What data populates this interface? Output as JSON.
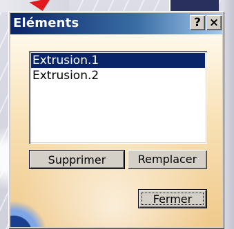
{
  "dialog": {
    "title": "Eléments",
    "help_glyph": "?",
    "close_glyph": "×"
  },
  "list": {
    "items": [
      {
        "label": "Extrusion.1",
        "selected": true
      },
      {
        "label": "Extrusion.2",
        "selected": false
      }
    ]
  },
  "buttons": {
    "supprimer": "Supprimer",
    "remplacer": "Remplacer",
    "fermer": "Fermer"
  },
  "colors": {
    "titlebar_start": "#0a246a",
    "titlebar_end": "#a6caf0",
    "selection": "#0a246a",
    "accent_arrow": "#e11b1b"
  }
}
